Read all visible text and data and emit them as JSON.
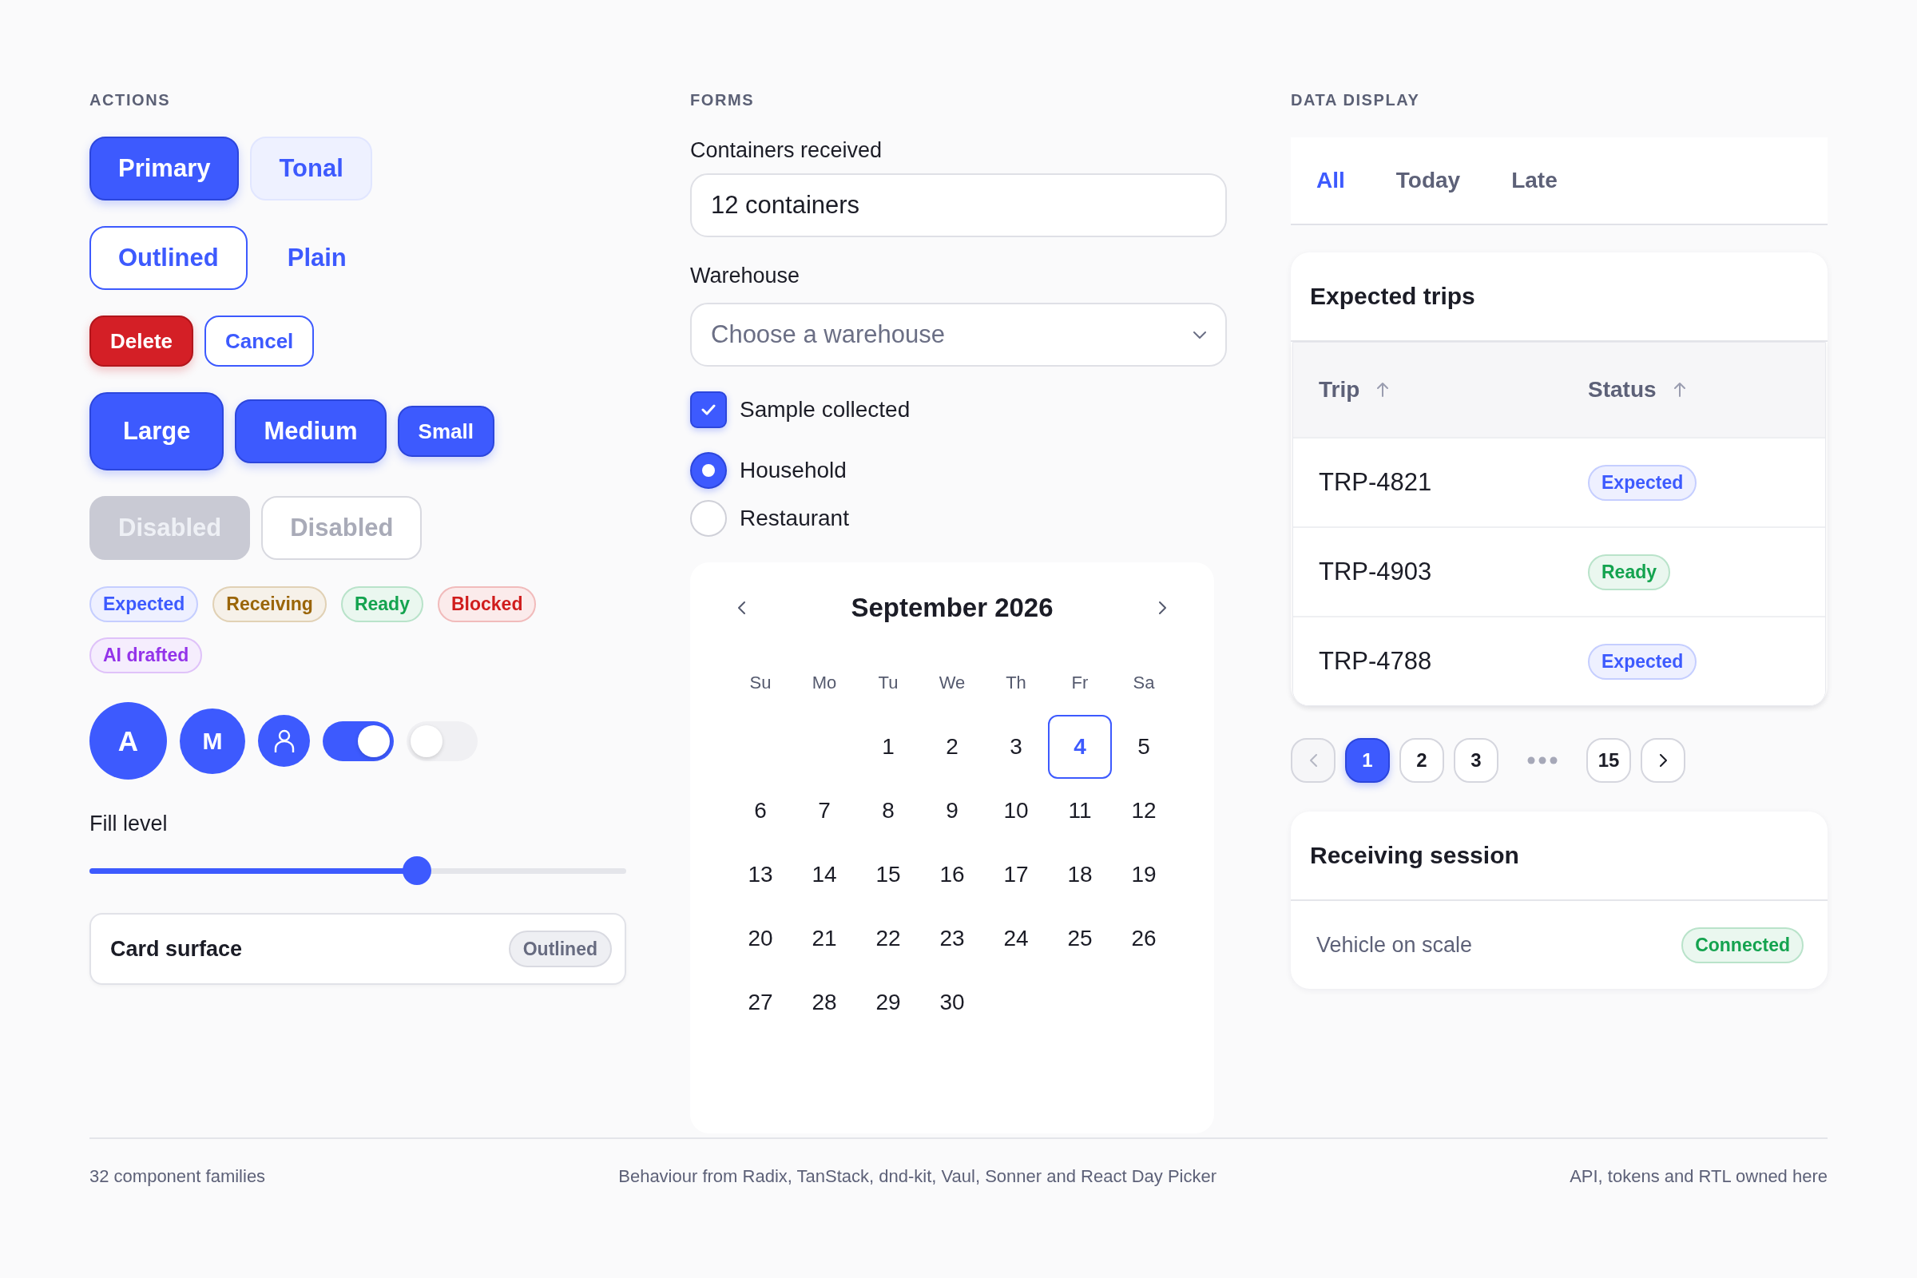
{
  "actions": {
    "heading": "ACTIONS",
    "button_rows": [
      [
        {
          "label": "Primary",
          "kind": "filled-medium",
          "disabled": false
        },
        {
          "label": "Tonal",
          "kind": "tonal-medium",
          "disabled": false
        }
      ],
      [
        {
          "label": "Outlined",
          "kind": "outlined-medium",
          "disabled": false
        },
        {
          "label": "Plain",
          "kind": "plain-medium",
          "disabled": false
        }
      ],
      [
        {
          "label": "Delete",
          "kind": "danger-small",
          "disabled": false
        },
        {
          "label": "Cancel",
          "kind": "outlined-small",
          "disabled": false
        }
      ],
      [
        {
          "label": "Large",
          "kind": "filled-large",
          "disabled": false
        },
        {
          "label": "Medium",
          "kind": "filled-medium",
          "disabled": false
        },
        {
          "label": "Small",
          "kind": "filled-small",
          "disabled": false
        }
      ],
      [
        {
          "label": "Disabled",
          "kind": "filled-medium",
          "disabled": true
        },
        {
          "label": "Disabled",
          "kind": "outlined-medium",
          "disabled": true
        }
      ]
    ],
    "badges": [
      {
        "label": "Expected",
        "color": "#3d5afe"
      },
      {
        "label": "Receiving",
        "color": "#9a6508"
      },
      {
        "label": "Ready",
        "color": "#14a34f"
      },
      {
        "label": "Blocked",
        "color": "#d01c1c"
      },
      {
        "label": "AI drafted",
        "color": "#9333ea"
      }
    ],
    "avatars": [
      {
        "kind": "initial-large",
        "text": "A"
      },
      {
        "kind": "initial-medium",
        "text": "M"
      },
      {
        "kind": "person-small"
      }
    ],
    "switches": [
      {
        "on": true
      },
      {
        "on": false
      }
    ],
    "slider": {
      "label": "Fill level",
      "level": 0.61
    },
    "card": {
      "title": "Card surface",
      "tag": "Outlined"
    }
  },
  "forms": {
    "heading": "FORMS",
    "text_field": {
      "label": "Containers received",
      "value": "12 containers"
    },
    "select": {
      "label": "Warehouse",
      "placeholder": "Choose a warehouse"
    },
    "checkbox": {
      "label": "Sample collected",
      "checked": true
    },
    "radios": [
      {
        "label": "Household",
        "selected": true
      },
      {
        "label": "Restaurant",
        "selected": false
      }
    ],
    "calendar": {
      "title": "September 2026",
      "weekdays": [
        "Su",
        "Mo",
        "Tu",
        "We",
        "Th",
        "Fr",
        "Sa"
      ],
      "weeks": [
        [
          {
            "label": "1",
            "selected": false
          },
          {
            "label": "2",
            "selected": false
          },
          {
            "label": "3",
            "selected": false
          },
          {
            "label": "4",
            "selected": true
          },
          {
            "label": "5",
            "selected": false
          }
        ],
        [
          {
            "label": "6",
            "selected": false
          },
          {
            "label": "7",
            "selected": false
          },
          {
            "label": "8",
            "selected": false
          },
          {
            "label": "9",
            "selected": false
          },
          {
            "label": "10",
            "selected": false
          },
          {
            "label": "11",
            "selected": false
          },
          {
            "label": "12",
            "selected": false
          }
        ],
        [
          {
            "label": "13",
            "selected": false
          },
          {
            "label": "14",
            "selected": false
          },
          {
            "label": "15",
            "selected": false
          },
          {
            "label": "16",
            "selected": false
          },
          {
            "label": "17",
            "selected": false
          },
          {
            "label": "18",
            "selected": false
          },
          {
            "label": "19",
            "selected": false
          }
        ],
        [
          {
            "label": "20",
            "selected": false
          },
          {
            "label": "21",
            "selected": false
          },
          {
            "label": "22",
            "selected": false
          },
          {
            "label": "23",
            "selected": false
          },
          {
            "label": "24",
            "selected": false
          },
          {
            "label": "25",
            "selected": false
          },
          {
            "label": "26",
            "selected": false
          }
        ],
        [
          {
            "label": "27",
            "selected": false
          },
          {
            "label": "28",
            "selected": false
          },
          {
            "label": "29",
            "selected": false
          },
          {
            "label": "30",
            "selected": false
          }
        ]
      ]
    }
  },
  "data_display": {
    "heading": "DATA DISPLAY",
    "tabs": [
      {
        "label": "All",
        "selected": true
      },
      {
        "label": "Today",
        "selected": false
      },
      {
        "label": "Late",
        "selected": false
      }
    ],
    "table_card": {
      "title": "Expected trips",
      "columns": [
        {
          "label": "Trip",
          "sorted_ascending": true
        },
        {
          "label": "Status",
          "sorted_ascending": true
        }
      ],
      "rows": [
        {
          "trip": "TRP-4821",
          "status": {
            "label": "Expected",
            "color": "#3d5afe"
          }
        },
        {
          "trip": "TRP-4903",
          "status": {
            "label": "Ready",
            "color": "#14a34f"
          }
        },
        {
          "trip": "TRP-4788",
          "status": {
            "label": "Expected",
            "color": "#3d5afe"
          }
        }
      ]
    },
    "pagination": {
      "previous_disabled": true,
      "next_disabled": false,
      "pages": [
        {
          "label": "1",
          "selected": true
        },
        {
          "label": "2",
          "selected": false
        },
        {
          "label": "3",
          "selected": false
        },
        {
          "kind": "ellipsis"
        },
        {
          "label": "15",
          "selected": false
        }
      ]
    },
    "session_card": {
      "title": "Receiving session",
      "row_label": "Vehicle on scale",
      "badge": {
        "label": "Connected",
        "color": "#14a34f"
      }
    }
  },
  "footer": {
    "left": "32 component families",
    "center": "Behaviour from Radix, TanStack, dnd-kit, Vaul, Sonner and React Day Picker",
    "right": "API, tokens and RTL owned here"
  }
}
